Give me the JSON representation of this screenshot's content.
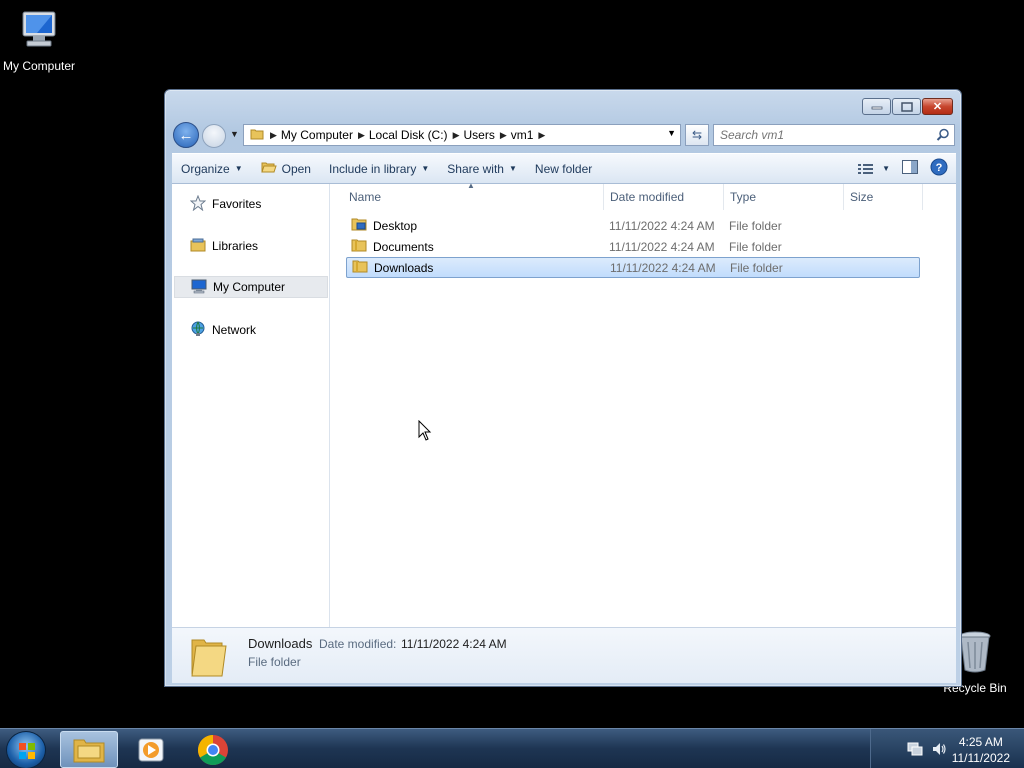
{
  "desktop": {
    "icons": [
      {
        "label": "My Computer"
      },
      {
        "label": "Recycle Bin"
      }
    ]
  },
  "window": {
    "caption_buttons": {
      "minimize": "minimize",
      "maximize": "maximize",
      "close": "✕"
    },
    "address": {
      "crumbs": [
        "My Computer",
        "Local Disk (C:)",
        "Users",
        "vm1"
      ]
    },
    "search": {
      "placeholder": "Search vm1"
    },
    "toolbar": {
      "organize": "Organize",
      "open": "Open",
      "include_in_library": "Include in library",
      "share_with": "Share with",
      "new_folder": "New folder"
    },
    "nav": {
      "favorites": "Favorites",
      "libraries": "Libraries",
      "my_computer": "My Computer",
      "network": "Network"
    },
    "columns": {
      "name": "Name",
      "date": "Date modified",
      "type": "Type",
      "size": "Size"
    },
    "files": [
      {
        "name": "Desktop",
        "date": "11/11/2022 4:24 AM",
        "type": "File folder"
      },
      {
        "name": "Documents",
        "date": "11/11/2022 4:24 AM",
        "type": "File folder"
      },
      {
        "name": "Downloads",
        "date": "11/11/2022 4:24 AM",
        "type": "File folder"
      }
    ],
    "details": {
      "name": "Downloads",
      "date_label": "Date modified:",
      "date_value": "11/11/2022 4:24 AM",
      "type": "File folder"
    }
  },
  "taskbar": {
    "clock_time": "4:25 AM",
    "clock_date": "11/11/2022"
  },
  "colors": {
    "desktop_bg": "#000000",
    "selection": "#c1dcfc",
    "taskbar": "#1e3553"
  }
}
